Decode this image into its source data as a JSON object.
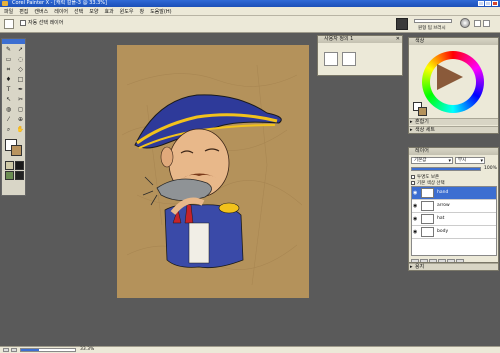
{
  "window": {
    "title": "Corel Painter X - [캐릭 컬플-3 @ 33.3%]"
  },
  "menu": {
    "items": [
      "파일",
      "편집",
      "캔버스",
      "레이어",
      "선택",
      "모양",
      "효과",
      "윈도우",
      "창",
      "도움말(H)"
    ]
  },
  "propbar": {
    "auto_select_label": "자동 선택 레이어",
    "brush_size_label": "원형 팁 브러시"
  },
  "custom_palette": {
    "title": "사용자 정의 1"
  },
  "colors_panel": {
    "title": "색상",
    "hue_ring_colors": [
      "#ff0000",
      "#ff00ff",
      "#0000ff",
      "#00ffff",
      "#00ff00",
      "#ffff00"
    ],
    "selected_color": "#8a5a3a",
    "main_color": "#ffffff",
    "secondary_color": "#b4925b",
    "sections": [
      "혼합기",
      "색상 세트"
    ]
  },
  "layers_panel": {
    "title": "레이어",
    "composite_method": "기본값",
    "composite_depth": "무시",
    "opacity_percent": 100,
    "opacity_label": "100%",
    "options": [
      "투명도 보존",
      "기본 색상 선택"
    ],
    "layers": [
      {
        "name": "hand",
        "selected": true
      },
      {
        "name": "arrow",
        "selected": false
      },
      {
        "name": "hat",
        "selected": false
      },
      {
        "name": "body",
        "selected": false
      }
    ]
  },
  "paper_panel": {
    "title": "용지"
  },
  "statusbar": {
    "zoom_label": "33.3%",
    "zoom_level": 0.333
  },
  "colors": {
    "titlebar": "#1b4fb8",
    "chrome": "#ece9d8",
    "workspace": "#5a5a5a",
    "paper": "#b4925b"
  }
}
